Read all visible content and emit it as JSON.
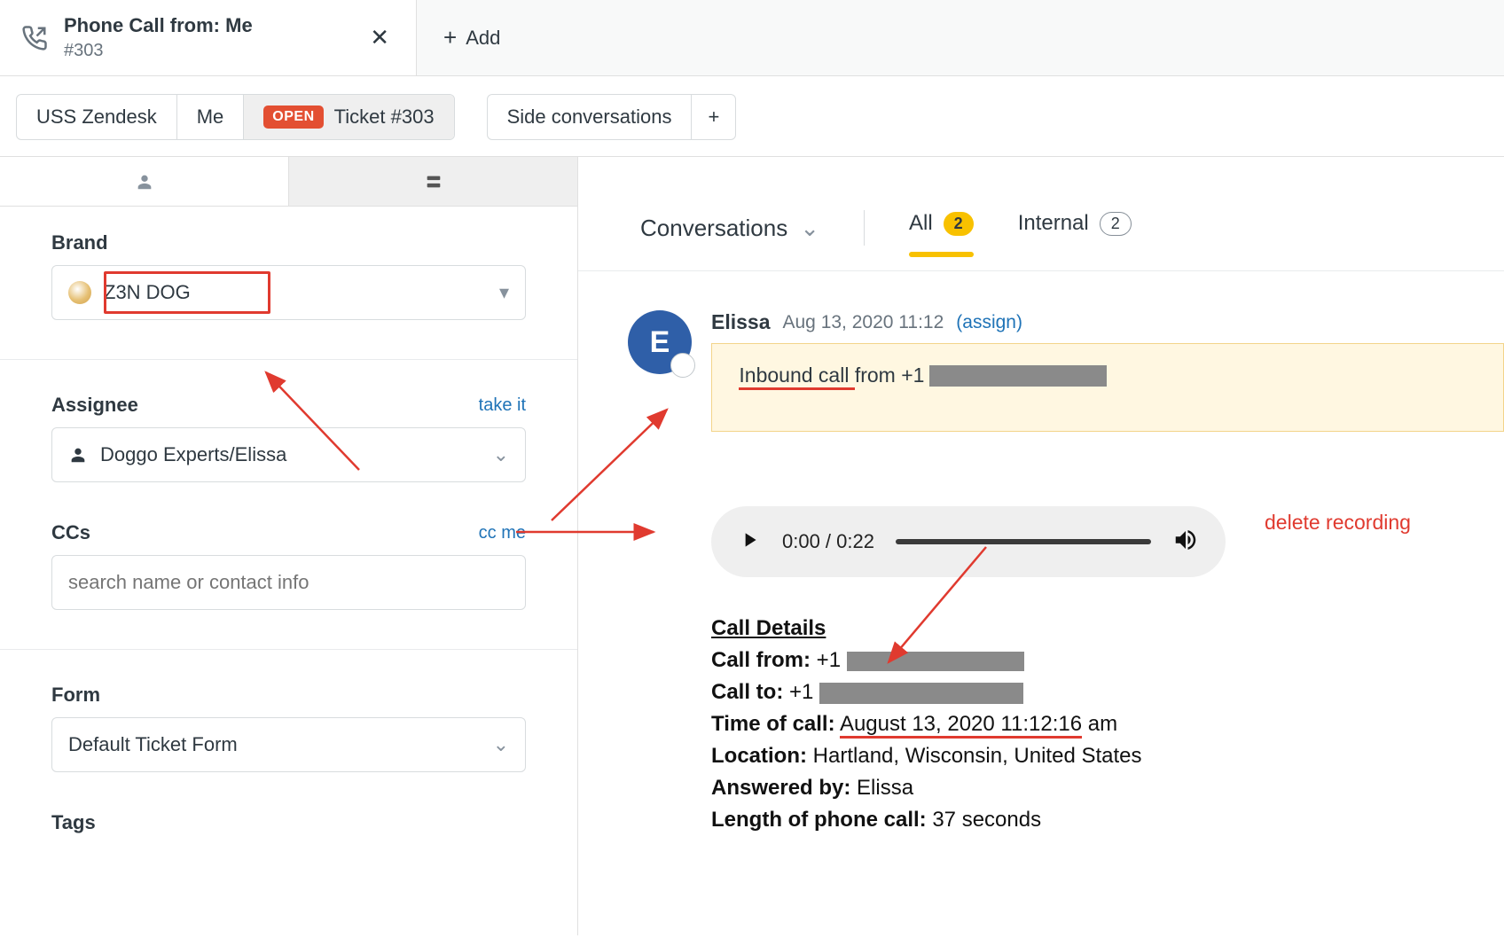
{
  "tab": {
    "title": "Phone Call from: Me",
    "subtitle": "#303",
    "add_label": "Add"
  },
  "crumbs": {
    "org": "USS Zendesk",
    "user": "Me",
    "status": "OPEN",
    "ticket": "Ticket #303",
    "side_conv": "Side conversations",
    "plus": "+"
  },
  "left": {
    "brand_label": "Brand",
    "brand_value": "Z3N DOG",
    "assignee_label": "Assignee",
    "assignee_value": "Doggo Experts/Elissa",
    "take_it": "take it",
    "ccs_label": "CCs",
    "cc_me": "cc me",
    "ccs_placeholder": "search name or contact info",
    "form_label": "Form",
    "form_value": "Default Ticket Form",
    "tags_label": "Tags"
  },
  "conv": {
    "conversations_label": "Conversations",
    "all_label": "All",
    "all_count": "2",
    "internal_label": "Internal",
    "internal_count": "2"
  },
  "comment": {
    "avatar_initial": "E",
    "name": "Elissa",
    "ts": "Aug 13, 2020 11:12",
    "assign": "(assign)",
    "inbound_prefix": "Inbound call ",
    "inbound_from": "from +1"
  },
  "audio": {
    "time_label": "0:00 / 0:22",
    "delete_label": "delete recording"
  },
  "call": {
    "header": "Call Details",
    "from_label": "Call from:",
    "from_prefix": " +1 ",
    "to_label": "Call to:",
    "to_prefix": " +1 ",
    "time_label": "Time of call:",
    "time_value_underlined": "August 13, 2020 11:12:16",
    "time_suffix": " am",
    "location_label": "Location:",
    "location_value": " Hartland, Wisconsin, United States",
    "answered_label": "Answered by:",
    "answered_value": " Elissa",
    "length_label": "Length of phone call:",
    "length_value": " 37 seconds"
  }
}
